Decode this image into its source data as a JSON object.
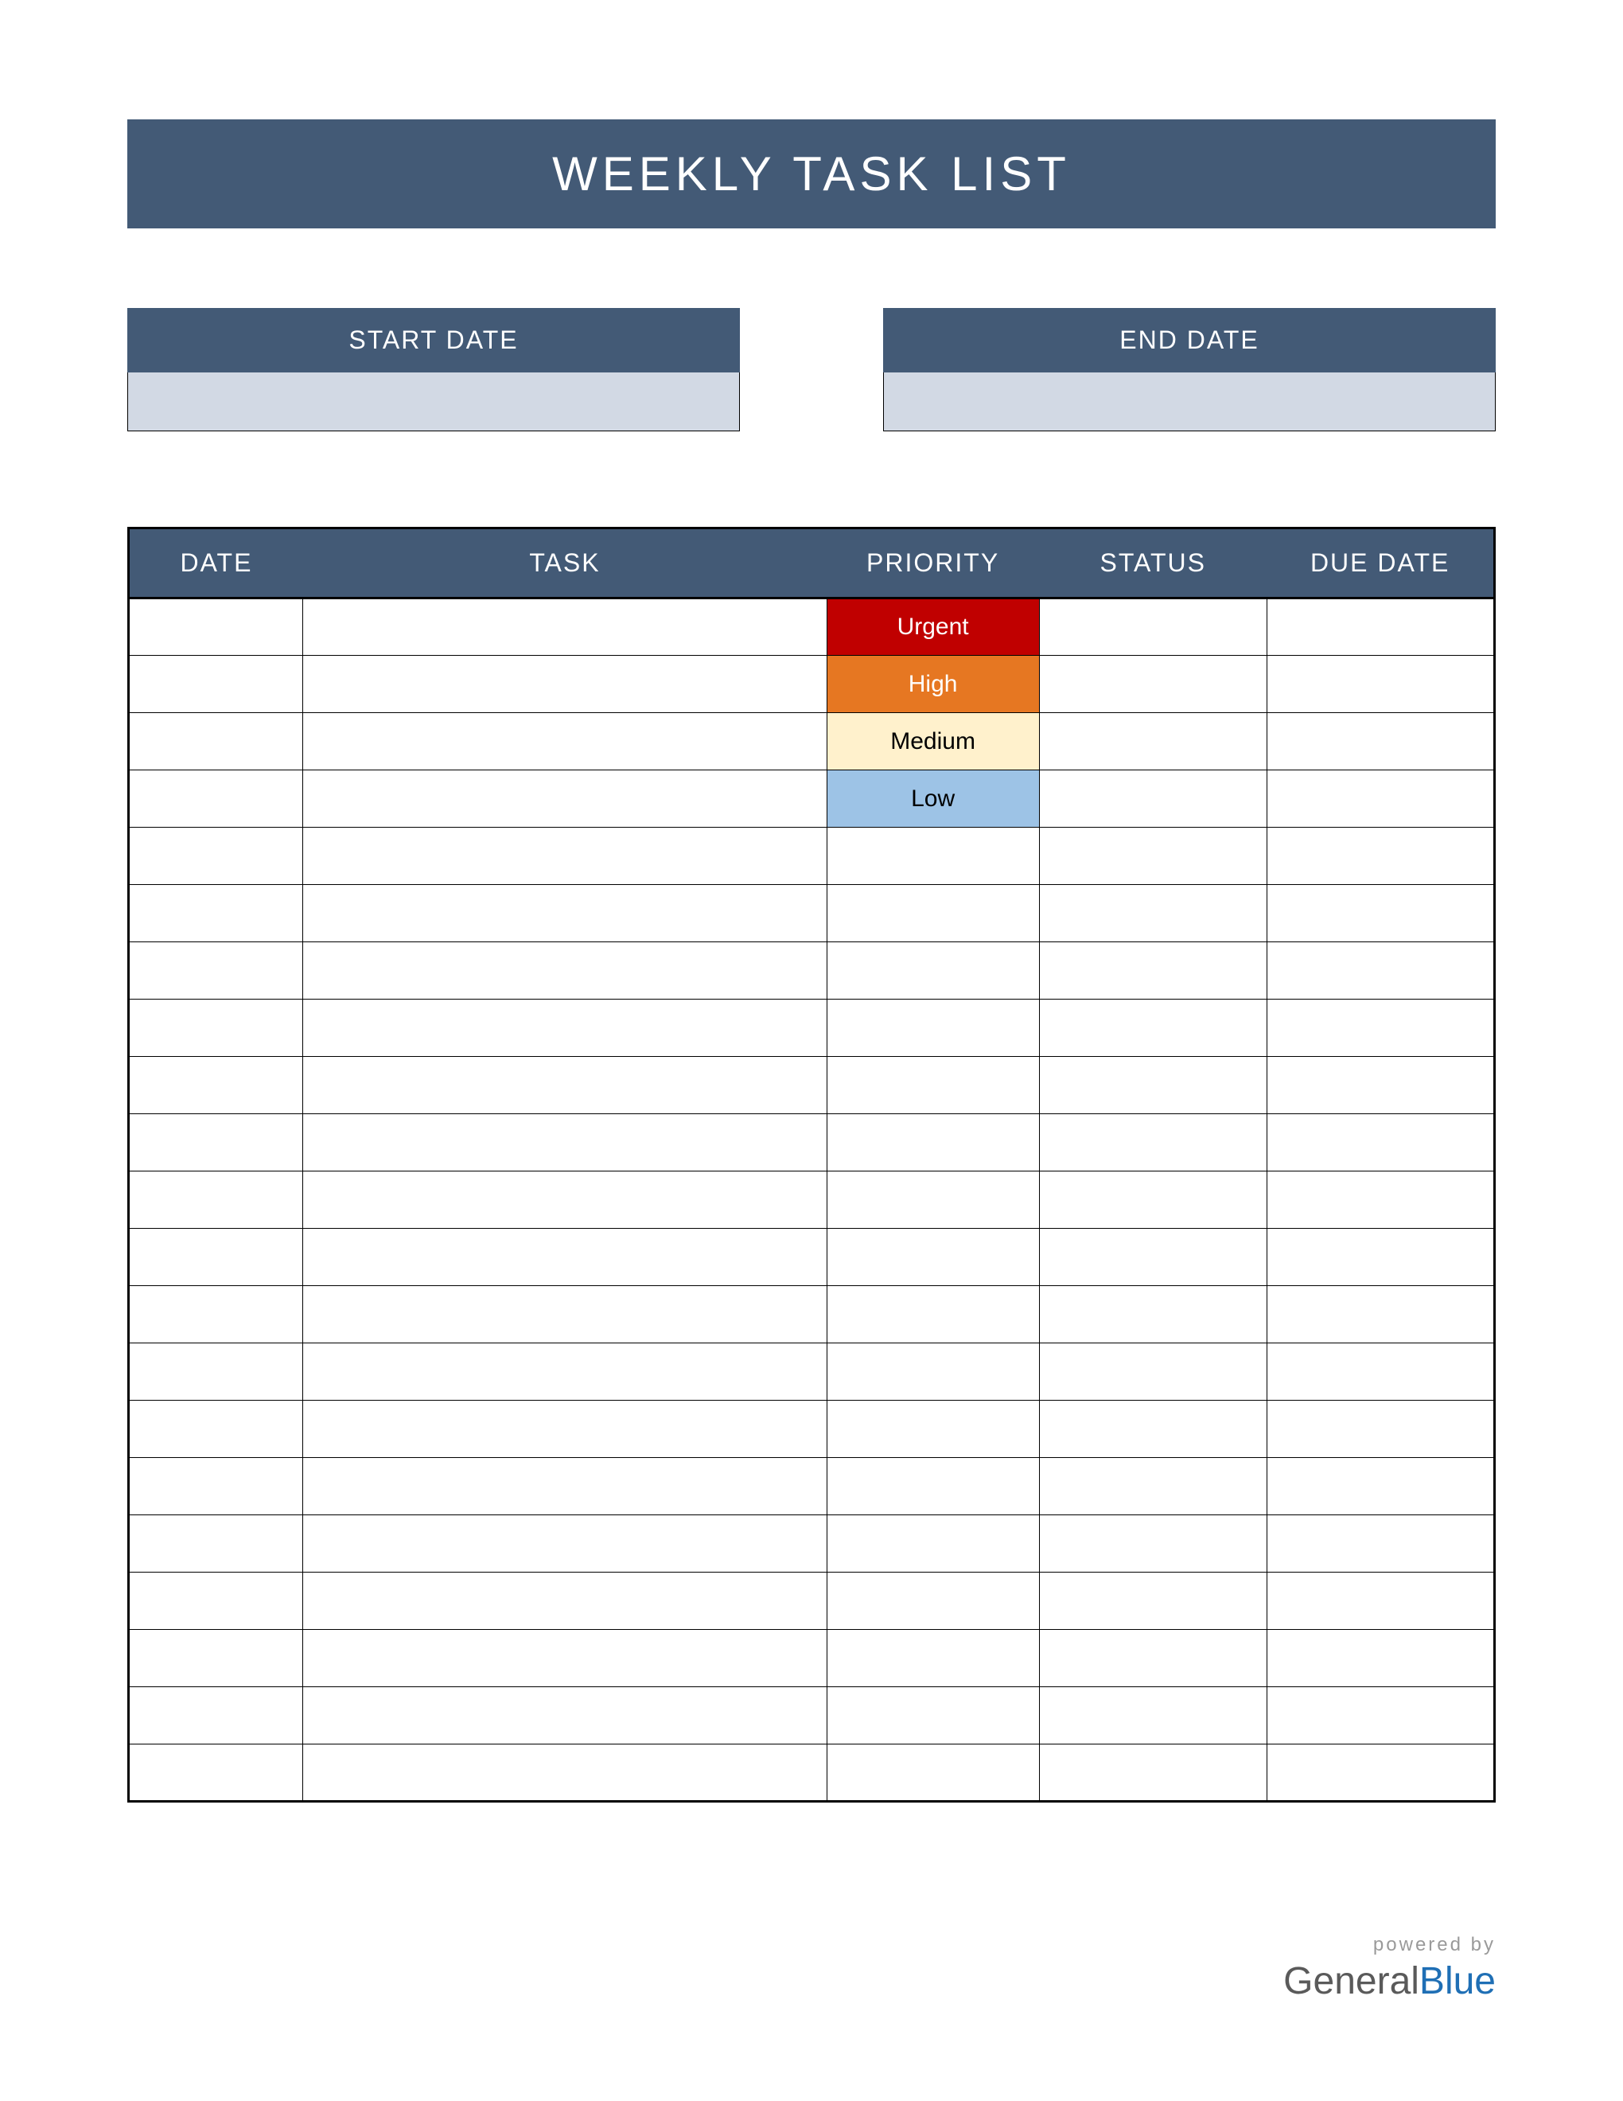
{
  "title": "WEEKLY TASK LIST",
  "dates": {
    "start_label": "START DATE",
    "start_value": "",
    "end_label": "END DATE",
    "end_value": ""
  },
  "columns": {
    "date": "DATE",
    "task": "TASK",
    "priority": "PRIORITY",
    "status": "STATUS",
    "due": "DUE DATE"
  },
  "rows": [
    {
      "date": "",
      "task": "",
      "priority": "Urgent",
      "priority_class": "p-urgent",
      "status": "",
      "due": ""
    },
    {
      "date": "",
      "task": "",
      "priority": "High",
      "priority_class": "p-high",
      "status": "",
      "due": ""
    },
    {
      "date": "",
      "task": "",
      "priority": "Medium",
      "priority_class": "p-medium",
      "status": "",
      "due": ""
    },
    {
      "date": "",
      "task": "",
      "priority": "Low",
      "priority_class": "p-low",
      "status": "",
      "due": ""
    },
    {
      "date": "",
      "task": "",
      "priority": "",
      "priority_class": "",
      "status": "",
      "due": ""
    },
    {
      "date": "",
      "task": "",
      "priority": "",
      "priority_class": "",
      "status": "",
      "due": ""
    },
    {
      "date": "",
      "task": "",
      "priority": "",
      "priority_class": "",
      "status": "",
      "due": ""
    },
    {
      "date": "",
      "task": "",
      "priority": "",
      "priority_class": "",
      "status": "",
      "due": ""
    },
    {
      "date": "",
      "task": "",
      "priority": "",
      "priority_class": "",
      "status": "",
      "due": ""
    },
    {
      "date": "",
      "task": "",
      "priority": "",
      "priority_class": "",
      "status": "",
      "due": ""
    },
    {
      "date": "",
      "task": "",
      "priority": "",
      "priority_class": "",
      "status": "",
      "due": ""
    },
    {
      "date": "",
      "task": "",
      "priority": "",
      "priority_class": "",
      "status": "",
      "due": ""
    },
    {
      "date": "",
      "task": "",
      "priority": "",
      "priority_class": "",
      "status": "",
      "due": ""
    },
    {
      "date": "",
      "task": "",
      "priority": "",
      "priority_class": "",
      "status": "",
      "due": ""
    },
    {
      "date": "",
      "task": "",
      "priority": "",
      "priority_class": "",
      "status": "",
      "due": ""
    },
    {
      "date": "",
      "task": "",
      "priority": "",
      "priority_class": "",
      "status": "",
      "due": ""
    },
    {
      "date": "",
      "task": "",
      "priority": "",
      "priority_class": "",
      "status": "",
      "due": ""
    },
    {
      "date": "",
      "task": "",
      "priority": "",
      "priority_class": "",
      "status": "",
      "due": ""
    },
    {
      "date": "",
      "task": "",
      "priority": "",
      "priority_class": "",
      "status": "",
      "due": ""
    },
    {
      "date": "",
      "task": "",
      "priority": "",
      "priority_class": "",
      "status": "",
      "due": ""
    },
    {
      "date": "",
      "task": "",
      "priority": "",
      "priority_class": "",
      "status": "",
      "due": ""
    }
  ],
  "footer": {
    "powered": "powered by",
    "brand_part1": "General",
    "brand_part2": "Blue"
  }
}
